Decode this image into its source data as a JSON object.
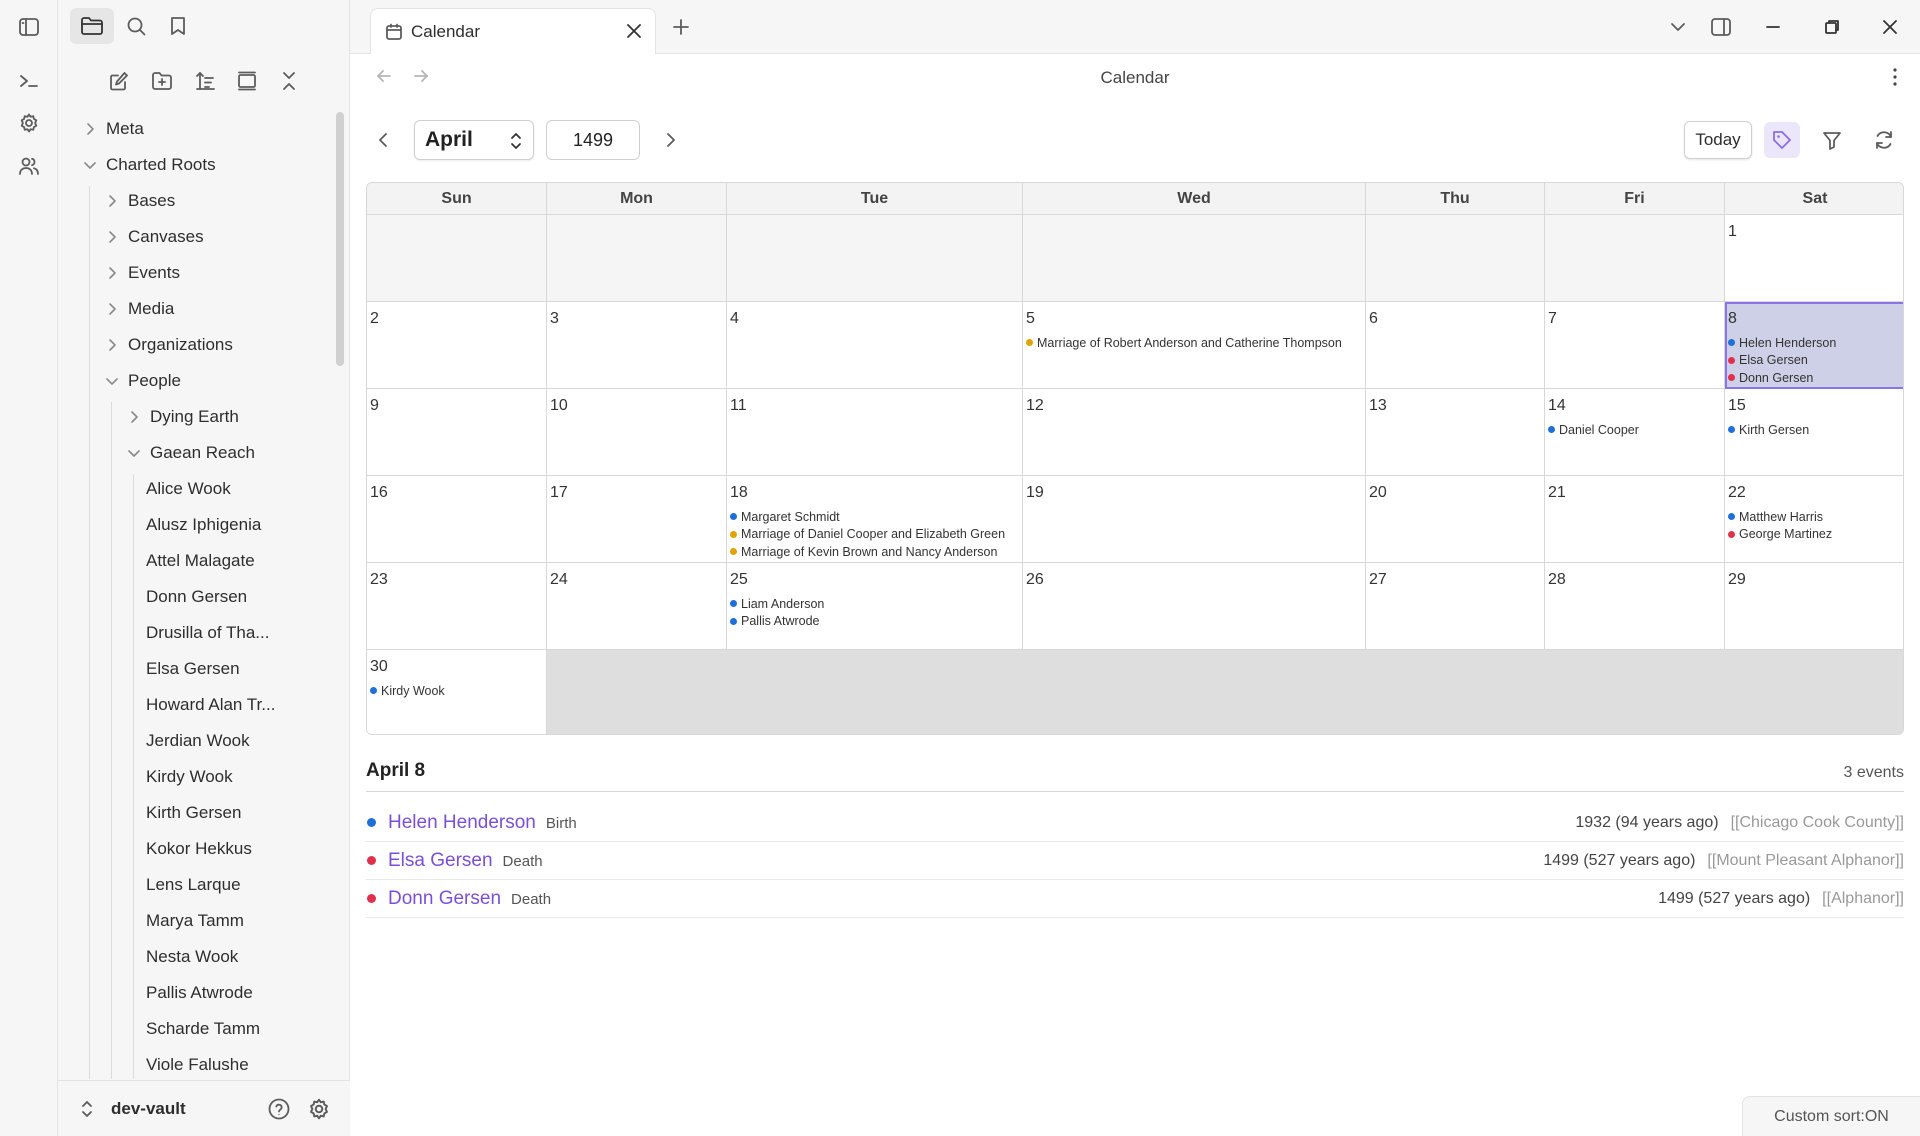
{
  "tab": {
    "title": "Calendar"
  },
  "view": {
    "title": "Calendar"
  },
  "controls": {
    "month": "April",
    "year": "1499",
    "today_label": "Today"
  },
  "sidebar": {
    "tree": [
      {
        "label": "Meta",
        "expanded": false
      },
      {
        "label": "Charted Roots",
        "expanded": true
      },
      {
        "label": "Bases",
        "expanded": false
      },
      {
        "label": "Canvases",
        "expanded": false
      },
      {
        "label": "Events",
        "expanded": false
      },
      {
        "label": "Media",
        "expanded": false
      },
      {
        "label": "Organizations",
        "expanded": false
      },
      {
        "label": "People",
        "expanded": true
      },
      {
        "label": "Dying Earth",
        "expanded": false
      },
      {
        "label": "Gaean Reach",
        "expanded": true
      },
      {
        "label": "Alice Wook"
      },
      {
        "label": "Alusz Iphigenia"
      },
      {
        "label": "Attel Malagate"
      },
      {
        "label": "Donn Gersen"
      },
      {
        "label": "Drusilla of Tha..."
      },
      {
        "label": "Elsa Gersen"
      },
      {
        "label": "Howard Alan Tr..."
      },
      {
        "label": "Jerdian Wook"
      },
      {
        "label": "Kirdy Wook"
      },
      {
        "label": "Kirth Gersen"
      },
      {
        "label": "Kokor Hekkus"
      },
      {
        "label": "Lens Larque"
      },
      {
        "label": "Marya Tamm"
      },
      {
        "label": "Nesta Wook"
      },
      {
        "label": "Pallis Atwrode"
      },
      {
        "label": "Scharde Tamm"
      },
      {
        "label": "Viole Falushe"
      }
    ],
    "vault_name": "dev-vault"
  },
  "colors": {
    "blue": "#1f6fd8",
    "red": "#e0314b",
    "orange": "#e0a300",
    "accent": "#7b4fd6"
  },
  "calendar": {
    "weekdays": [
      "Sun",
      "Mon",
      "Tue",
      "Wed",
      "Thu",
      "Fri",
      "Sat"
    ],
    "weeks": [
      [
        {
          "day": "",
          "outside": true
        },
        {
          "day": "",
          "outside": true
        },
        {
          "day": "",
          "outside": true
        },
        {
          "day": "",
          "outside": true
        },
        {
          "day": "",
          "outside": true
        },
        {
          "day": "",
          "outside": true
        },
        {
          "day": "1"
        }
      ],
      [
        {
          "day": "2"
        },
        {
          "day": "3"
        },
        {
          "day": "4"
        },
        {
          "day": "5",
          "events": [
            {
              "label": "Marriage of Robert Anderson and Catherine Thompson",
              "color": "orange"
            }
          ]
        },
        {
          "day": "6"
        },
        {
          "day": "7"
        },
        {
          "day": "8",
          "selected": true,
          "events": [
            {
              "label": "Helen Henderson",
              "color": "blue"
            },
            {
              "label": "Elsa Gersen",
              "color": "red"
            },
            {
              "label": "Donn Gersen",
              "color": "red"
            }
          ]
        }
      ],
      [
        {
          "day": "9"
        },
        {
          "day": "10"
        },
        {
          "day": "11"
        },
        {
          "day": "12"
        },
        {
          "day": "13"
        },
        {
          "day": "14",
          "events": [
            {
              "label": "Daniel Cooper",
              "color": "blue"
            }
          ]
        },
        {
          "day": "15",
          "events": [
            {
              "label": "Kirth Gersen",
              "color": "blue"
            }
          ]
        }
      ],
      [
        {
          "day": "16"
        },
        {
          "day": "17"
        },
        {
          "day": "18",
          "events": [
            {
              "label": "Margaret Schmidt",
              "color": "blue"
            },
            {
              "label": "Marriage of Daniel Cooper and Elizabeth Green",
              "color": "orange"
            },
            {
              "label": "Marriage of Kevin Brown and Nancy Anderson",
              "color": "orange"
            }
          ]
        },
        {
          "day": "19"
        },
        {
          "day": "20"
        },
        {
          "day": "21"
        },
        {
          "day": "22",
          "events": [
            {
              "label": "Matthew Harris",
              "color": "blue"
            },
            {
              "label": "George Martinez",
              "color": "red"
            }
          ]
        }
      ],
      [
        {
          "day": "23"
        },
        {
          "day": "24"
        },
        {
          "day": "25",
          "events": [
            {
              "label": "Liam Anderson",
              "color": "blue"
            },
            {
              "label": "Pallis Atwrode",
              "color": "blue"
            }
          ]
        },
        {
          "day": "26"
        },
        {
          "day": "27"
        },
        {
          "day": "28"
        },
        {
          "day": "29"
        }
      ],
      [
        {
          "day": "30",
          "events": [
            {
              "label": "Kirdy Wook",
              "color": "blue"
            }
          ]
        },
        {
          "filler": true
        },
        {
          "filler": true
        },
        {
          "filler": true
        },
        {
          "filler": true
        },
        {
          "filler": true
        },
        {
          "filler": true
        }
      ]
    ]
  },
  "selected_day": {
    "title": "April 8",
    "count": "3 events",
    "events": [
      {
        "name": "Helen Henderson",
        "type": "Birth",
        "when": "1932 (94 years ago)",
        "place": "[[Chicago Cook County]]",
        "color": "blue"
      },
      {
        "name": "Elsa Gersen",
        "type": "Death",
        "when": "1499 (527 years ago)",
        "place": "[[Mount Pleasant Alphanor]]",
        "color": "red"
      },
      {
        "name": "Donn Gersen",
        "type": "Death",
        "when": "1499 (527 years ago)",
        "place": "[[Alphanor]]",
        "color": "red"
      }
    ]
  },
  "status_bar": {
    "text": "Custom sort:ON"
  }
}
